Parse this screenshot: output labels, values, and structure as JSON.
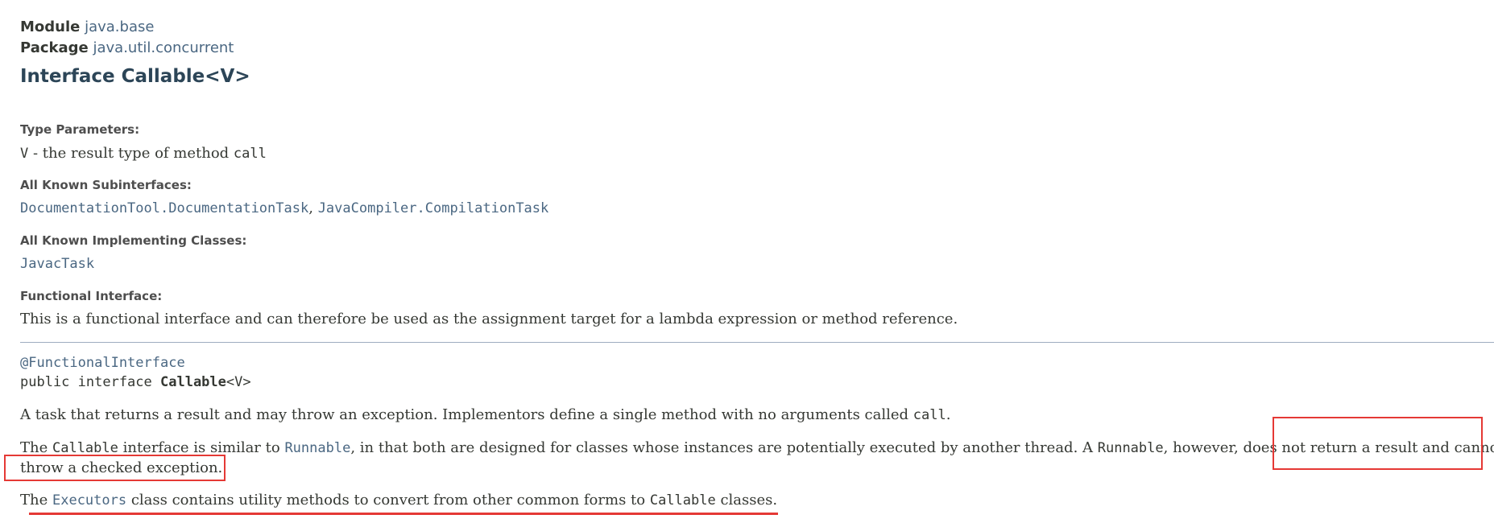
{
  "header": {
    "module_label": "Module",
    "module_value": "java.base",
    "package_label": "Package",
    "package_value": "java.util.concurrent",
    "title": "Interface Callable<V>"
  },
  "details": {
    "type_params_label": "Type Parameters:",
    "type_param_name": "V",
    "type_param_desc_1": " - the result type of method ",
    "type_param_code": "call",
    "subinterfaces_label": "All Known Subinterfaces:",
    "subinterface_1": "DocumentationTool.DocumentationTask",
    "subinterface_sep": ", ",
    "subinterface_2": "JavaCompiler.CompilationTask",
    "impl_label": "All Known Implementing Classes:",
    "impl_1": "JavacTask",
    "functional_label": "Functional Interface:",
    "functional_text": "This is a functional interface and can therefore be used as the assignment target for a lambda expression or method reference."
  },
  "signature": {
    "annotation": "@FunctionalInterface",
    "decl_prefix": "public interface ",
    "decl_name": "Callable",
    "decl_suffix": "<V>"
  },
  "description": {
    "p1_a": "A task that returns a result and may throw an exception. Implementors define a single method with no arguments called ",
    "p1_code": "call",
    "p1_b": ".",
    "p2_a": "The ",
    "p2_code1": "Callable",
    "p2_b": " interface is similar to ",
    "p2_link": "Runnable",
    "p2_c": ", in that both are designed for classes whose instances are potentially executed by another thread. A ",
    "p2_code2": "Runnable",
    "p2_d": ", however, does not return a result and cannot",
    "p2_line2": "throw a checked exception.",
    "p3_a": "The ",
    "p3_link": "Executors",
    "p3_b": " class contains utility methods to convert from other common forms to ",
    "p3_code": "Callable",
    "p3_c": " classes."
  },
  "annotations": {
    "color": "#e53935"
  }
}
